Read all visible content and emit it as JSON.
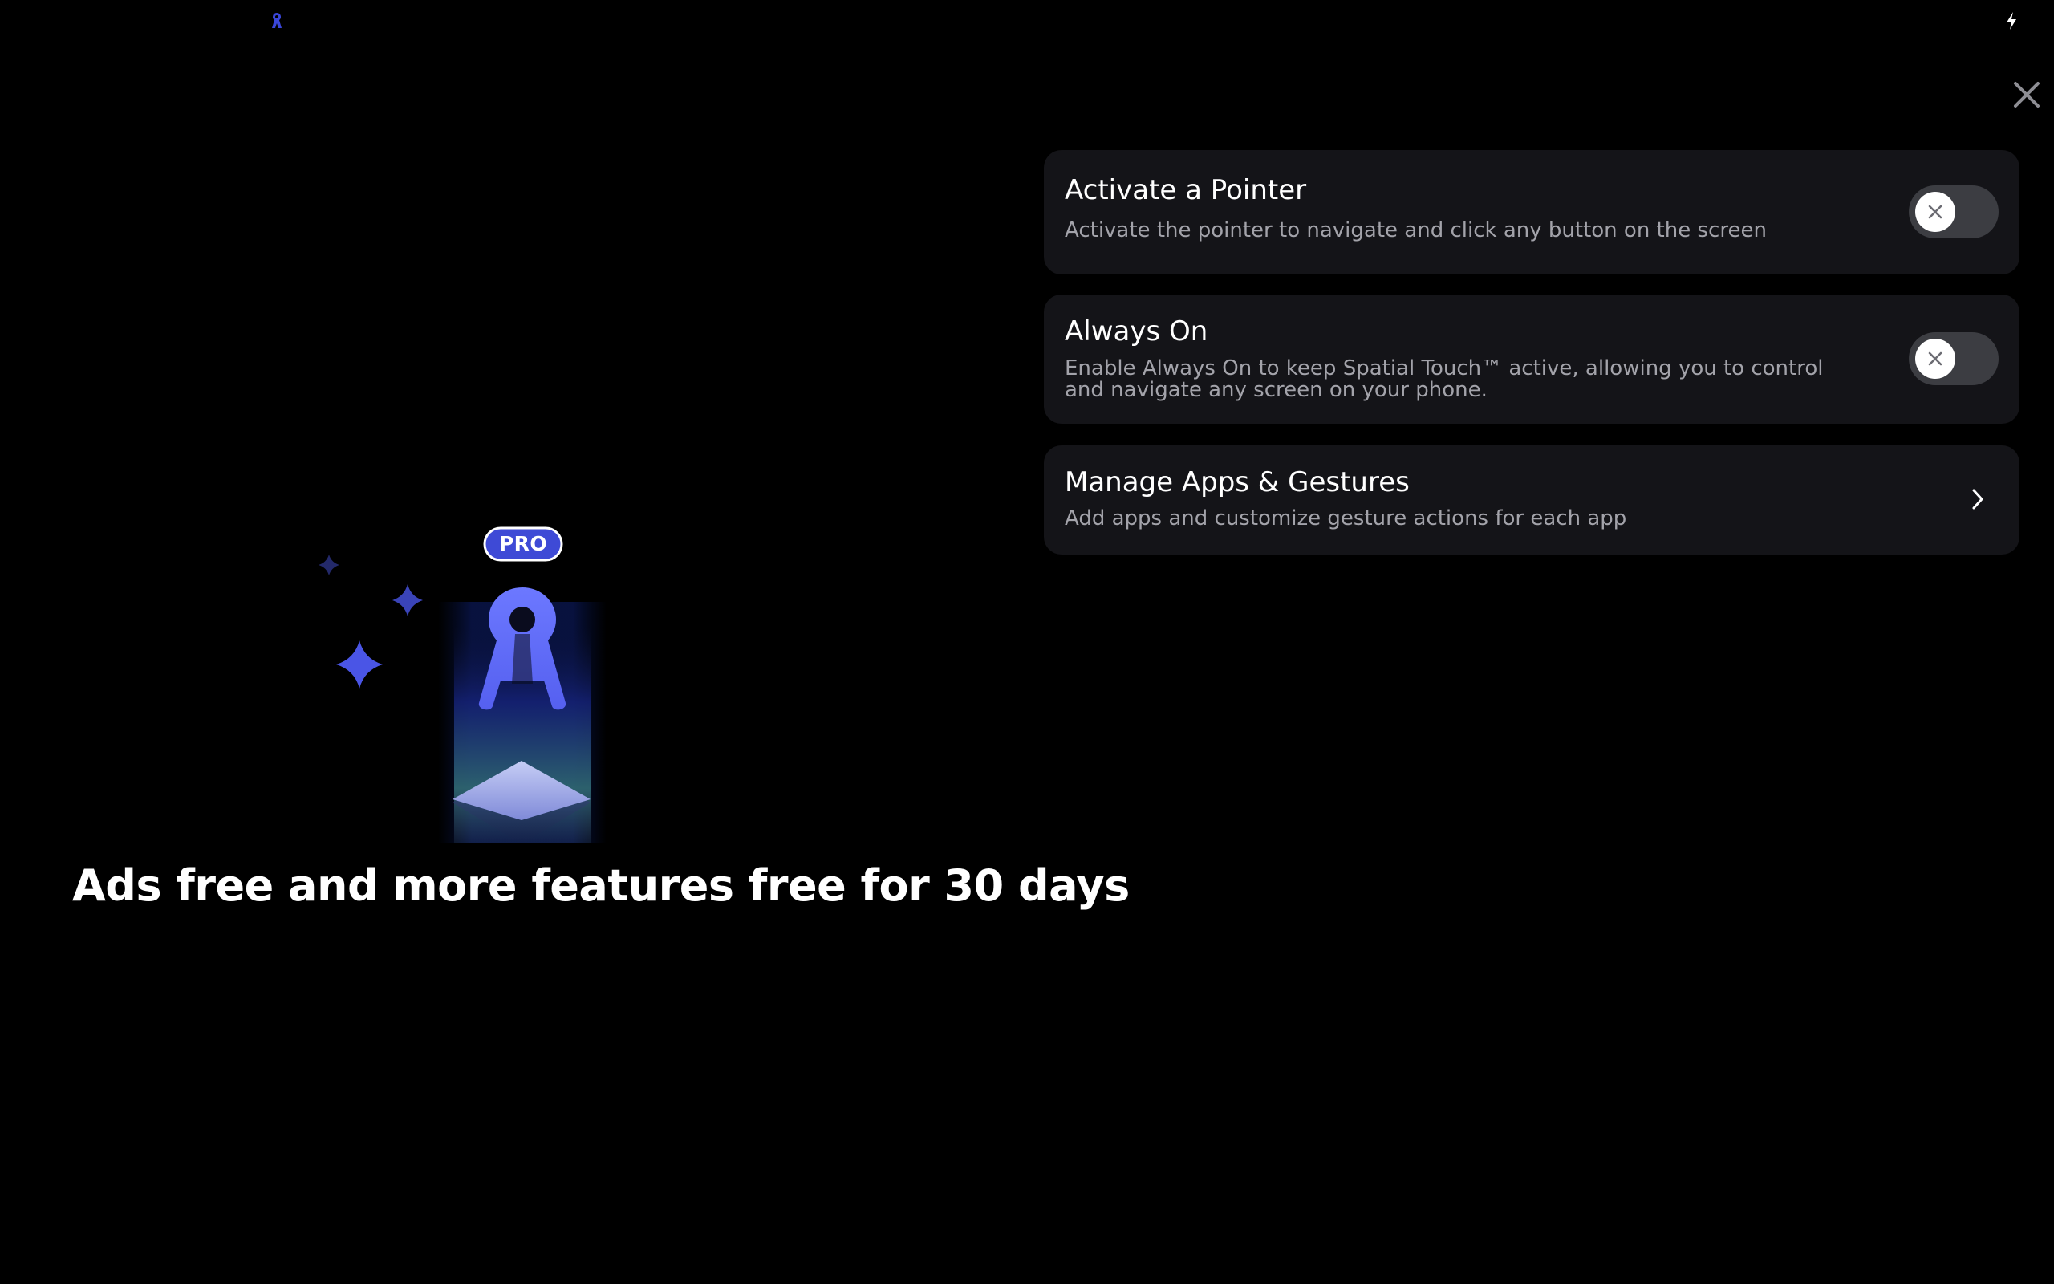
{
  "headline": "Ads free and more features free for 30 days",
  "promo": {
    "badge": "PRO",
    "icons": [
      "sparkle-icon",
      "app-logo-icon",
      "diamond-pedestal-icon"
    ]
  },
  "status_bar": {
    "icons": [
      "app-logo-icon",
      "bolt-icon"
    ]
  },
  "close_icon": "close-icon",
  "settings": {
    "pointer": {
      "title": "Activate a Pointer",
      "description": "Activate the pointer to navigate and click any button on the screen",
      "enabled": false
    },
    "always_on": {
      "title": "Always On",
      "description": "Enable Always On to keep Spatial Touch™ active, allowing you to control and navigate any screen on your phone.",
      "enabled": false
    },
    "manage_apps": {
      "title": "Manage Apps & Gestures",
      "description": "Add apps and customize gesture actions for each app"
    }
  },
  "colors": {
    "background": "#000000",
    "card": "#141418",
    "toggle_off": "#3c3d42",
    "accent": "#5a64f0",
    "text_secondary": "#a3a3aa"
  }
}
